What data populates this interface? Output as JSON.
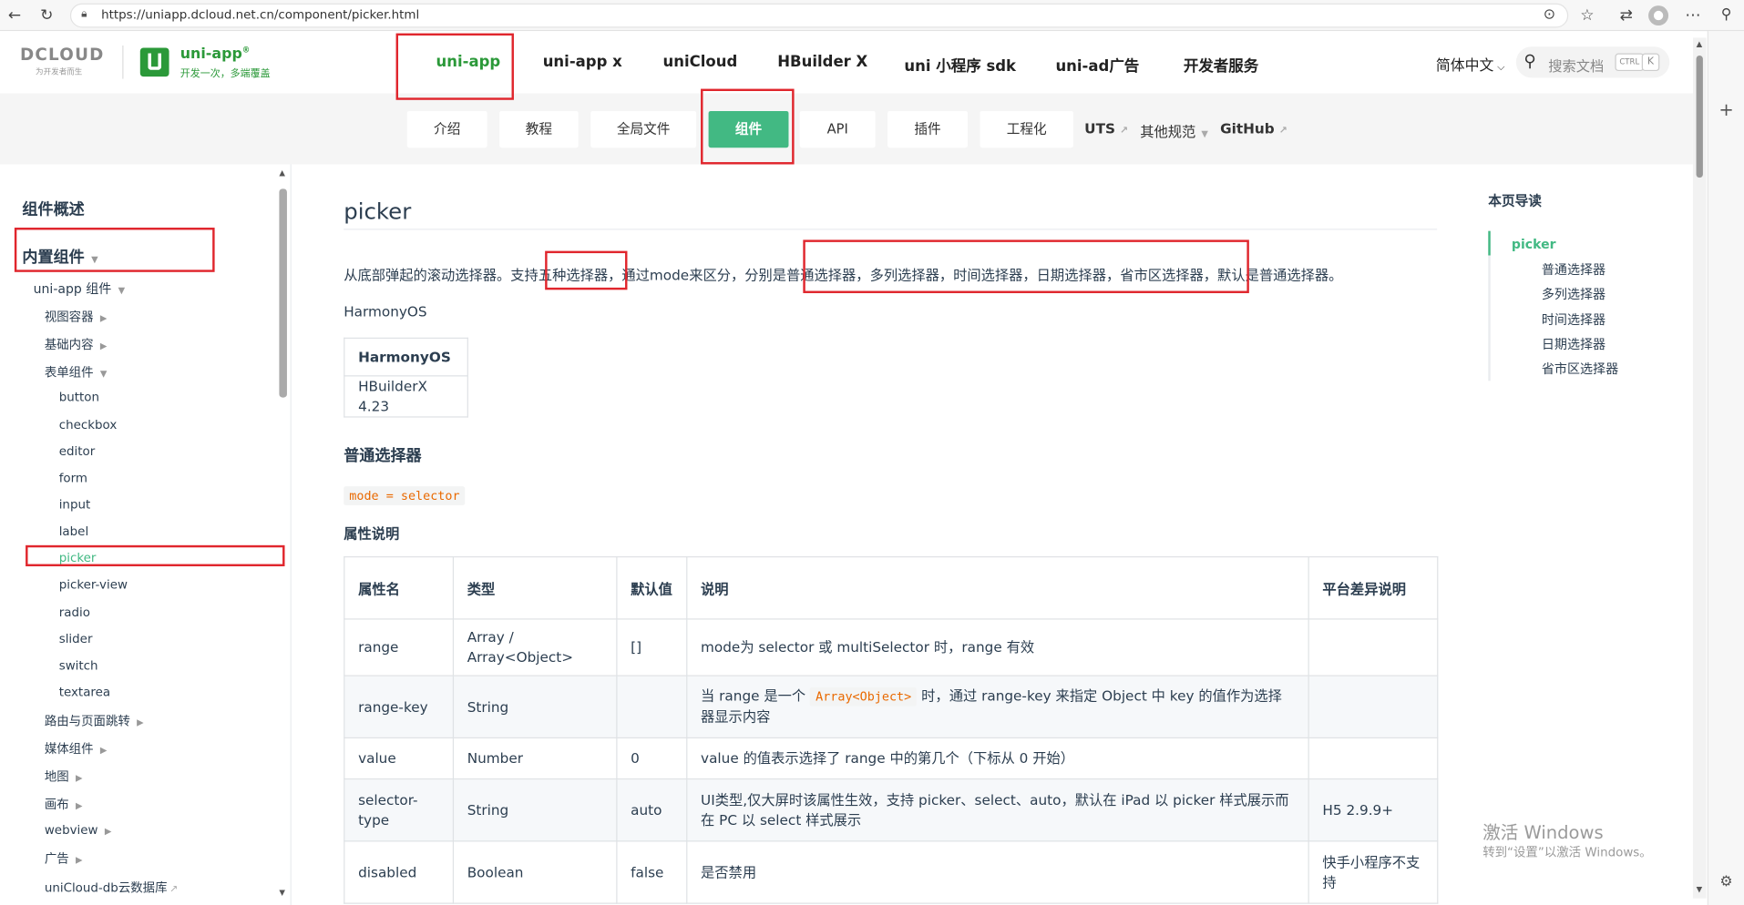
{
  "browser": {
    "url": "https://uniapp.dcloud.net.cn/component/picker.html",
    "icons": [
      "back-icon",
      "refresh-icon",
      "lock-icon",
      "reader-icon",
      "favorite-icon",
      "collections-icon",
      "profile-icon",
      "more-icon",
      "search-side-icon",
      "add-side-icon",
      "settings-icon"
    ]
  },
  "header": {
    "logo_text": "DCLOUD",
    "logo_slogan": "为开发者而生",
    "brand_name": "uni-app",
    "brand_reg": "®",
    "brand_slogan": "开发一次，多端覆盖",
    "nav": [
      "uni-app",
      "uni-app x",
      "uniCloud",
      "HBuilder X",
      "uni 小程序 sdk",
      "uni-ad广告",
      "开发者服务"
    ],
    "language": "简体中文",
    "search_placeholder": "搜索文档",
    "shortcut_ctrl": "CTRL",
    "shortcut_k": "K"
  },
  "subnav": {
    "buttons": [
      "介绍",
      "教程",
      "全局文件",
      "组件",
      "API",
      "插件",
      "工程化"
    ],
    "links": [
      "UTS",
      "其他规范",
      "GitHub"
    ]
  },
  "sidebar": {
    "overview": "组件概述",
    "builtin": "内置组件",
    "uniapp_components": "uni-app 组件",
    "groups": [
      "视图容器",
      "基础内容",
      "表单组件"
    ],
    "form_items": [
      "button",
      "checkbox",
      "editor",
      "form",
      "input",
      "label",
      "picker",
      "picker-view",
      "radio",
      "slider",
      "switch",
      "textarea"
    ],
    "more_groups": [
      "路由与页面跳转",
      "媒体组件",
      "地图",
      "画布",
      "webview",
      "广告",
      "uniCloud-db云数据库"
    ]
  },
  "content": {
    "title": "picker",
    "intro_prefix": "从底部弹起的滚动选择器。支持",
    "intro_five": "五种选择器",
    "intro_mid": "，通过mode来区分，分别是",
    "intro_list": "普通选择器，多列选择器，时间选择器，日期选择器，省市区选择器",
    "intro_suffix": "，默认是普通选择器。",
    "harmony_label": "HarmonyOS",
    "harmony_table": {
      "header": "HarmonyOS",
      "value": "HBuilderX 4.23"
    },
    "section_title": "普通选择器",
    "mode_code": "mode = selector",
    "props_title": "属性说明",
    "table_headers": [
      "属性名",
      "类型",
      "默认值",
      "说明",
      "平台差异说明"
    ],
    "rows": [
      {
        "name": "range",
        "type": "Array / Array<Object>",
        "default": "[]",
        "desc": "mode为 selector 或 multiSelector 时，range 有效",
        "platform": ""
      },
      {
        "name": "range-key",
        "type": "String",
        "default": "",
        "desc_pre": "当 range 是一个",
        "desc_code": "Array<Object>",
        "desc_post": "时，通过 range-key 来指定 Object 中 key 的值作为选择器显示内容",
        "platform": ""
      },
      {
        "name": "value",
        "type": "Number",
        "default": "0",
        "desc": "value 的值表示选择了 range 中的第几个（下标从 0 开始）",
        "platform": ""
      },
      {
        "name": "selector-type",
        "type": "String",
        "default": "auto",
        "desc": "UI类型,仅大屏时该属性生效，支持 picker、select、auto，默认在 iPad 以 picker 样式展示而在 PC 以 select 样式展示",
        "platform": "H5 2.9.9+"
      },
      {
        "name": "disabled",
        "type": "Boolean",
        "default": "false",
        "desc": "是否禁用",
        "platform": "快手小程序不支持"
      }
    ]
  },
  "toc": {
    "title": "本页导读",
    "items": [
      "picker",
      "普通选择器",
      "多列选择器",
      "时间选择器",
      "日期选择器",
      "省市区选择器"
    ]
  },
  "watermark": {
    "line1": "激活 Windows",
    "line2": "转到“设置”以激活 Windows。"
  },
  "colors": {
    "brand": "#2b9939",
    "accent_green": "#42b983",
    "highlight_red": "#e0262d",
    "code": "#e96900"
  }
}
